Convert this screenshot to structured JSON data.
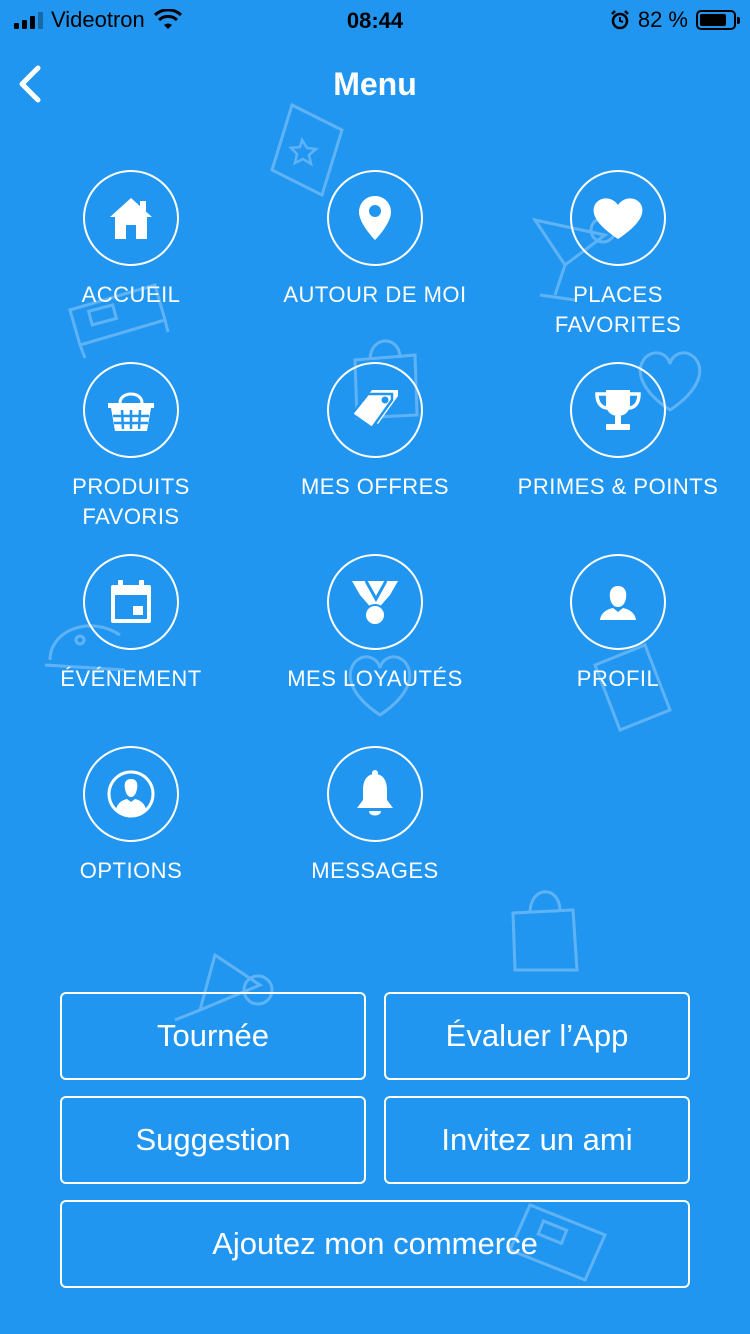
{
  "status_bar": {
    "carrier": "Videotron",
    "time": "08:44",
    "battery_percent": "82 %",
    "battery_level": 0.82,
    "icons": [
      "signal-icon",
      "wifi-icon",
      "alarm-icon",
      "battery-icon"
    ]
  },
  "nav": {
    "title": "Menu",
    "back_icon": "chevron-left-icon"
  },
  "menu_items": [
    {
      "label": "ACCUEIL",
      "icon": "home-icon"
    },
    {
      "label": "AUTOUR DE MOI",
      "icon": "location-pin-icon"
    },
    {
      "label": "PLACES\nFAVORITES",
      "icon": "heart-icon"
    },
    {
      "label": "PRODUITS\nFAVORIS",
      "icon": "basket-icon"
    },
    {
      "label": "MES OFFRES",
      "icon": "tags-icon"
    },
    {
      "label": "PRIMES & POINTS",
      "icon": "trophy-icon"
    },
    {
      "label": "ÉVÉNEMENT",
      "icon": "calendar-icon"
    },
    {
      "label": "MES LOYAUTÉS",
      "icon": "medal-icon"
    },
    {
      "label": "PROFIL",
      "icon": "user-icon"
    },
    {
      "label": "OPTIONS",
      "icon": "user-circle-icon"
    },
    {
      "label": "MESSAGES",
      "icon": "bell-icon"
    }
  ],
  "buttons": {
    "tour": "Tournée",
    "rate": "Évaluer l’App",
    "suggestion": "Suggestion",
    "invite": "Invitez un ami",
    "add_business": "Ajoutez mon commerce"
  },
  "colors": {
    "background": "#2196f1",
    "foreground": "#ffffff"
  }
}
